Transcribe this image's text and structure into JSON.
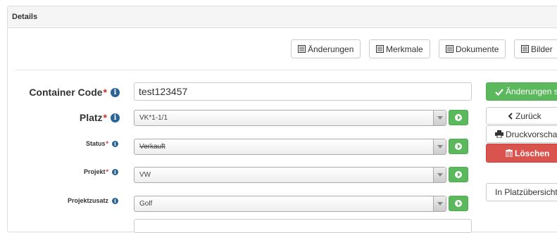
{
  "panel": {
    "heading": "Details"
  },
  "tabs": [
    {
      "label": "Änderungen",
      "icon": "list-icon"
    },
    {
      "label": "Merkmale",
      "icon": "list-icon"
    },
    {
      "label": "Dokumente",
      "icon": "list-icon"
    },
    {
      "label": "Bilder",
      "icon": "list-icon"
    }
  ],
  "form": {
    "required_marker": "*",
    "container_code": {
      "label": "Container Code",
      "value": "test123457"
    },
    "platz": {
      "label": "Platz",
      "value": "VK*1-1/1"
    },
    "status": {
      "label": "Status",
      "value": "Verkauft"
    },
    "projekt": {
      "label": "Projekt",
      "value": "VW"
    },
    "projektzusatz": {
      "label": "Projektzusatz",
      "value": "Golf"
    }
  },
  "actions": {
    "save_label": "Änderungen s",
    "back_label": "Zurück",
    "print_label": "Druckvorscha",
    "delete_label": "Löschen",
    "overview_label": "In Platzübersicht"
  },
  "colors": {
    "success": "#5cb85c",
    "danger": "#d9534f",
    "info": "#2a6496"
  }
}
